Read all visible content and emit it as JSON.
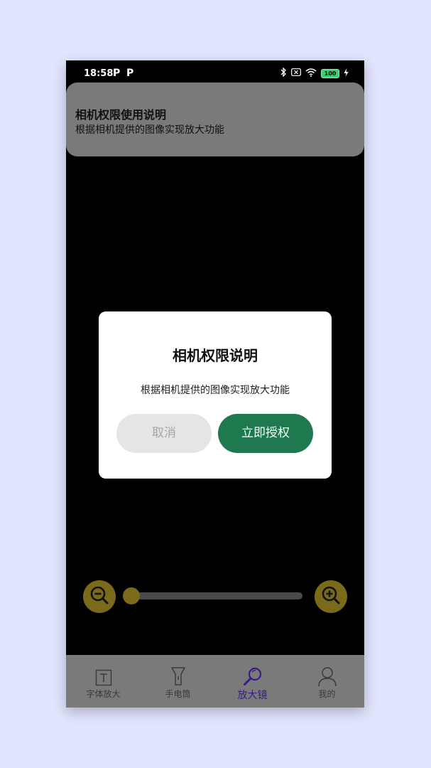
{
  "status_bar": {
    "time": "18:58",
    "indicators": [
      "P",
      "P"
    ],
    "icons": [
      "bluetooth-icon",
      "sim-off-icon",
      "wifi-icon",
      "battery-icon",
      "charging-icon"
    ],
    "battery": "100"
  },
  "notice": {
    "title": "相机权限使用说明",
    "description": "根据相机提供的图像实现放大功能"
  },
  "dialog": {
    "title": "相机权限说明",
    "message": "根据相机提供的图像实现放大功能",
    "cancel_label": "取消",
    "confirm_label": "立即授权"
  },
  "zoom": {
    "level": 0,
    "out_icon": "zoom-out-icon",
    "in_icon": "zoom-in-icon"
  },
  "tabs": [
    {
      "label": "字体放大",
      "icon": "text-icon",
      "active": false
    },
    {
      "label": "手电筒",
      "icon": "flashlight-icon",
      "active": false
    },
    {
      "label": "放大镜",
      "icon": "magnifier-icon",
      "active": true
    },
    {
      "label": "我的",
      "icon": "person-icon",
      "active": false
    }
  ],
  "colors": {
    "page_bg": "#e1e5fd",
    "accent_green": "#1e7a4e",
    "active_tab": "#3a1a8a",
    "zoom_gold": "#7a6a1a"
  }
}
